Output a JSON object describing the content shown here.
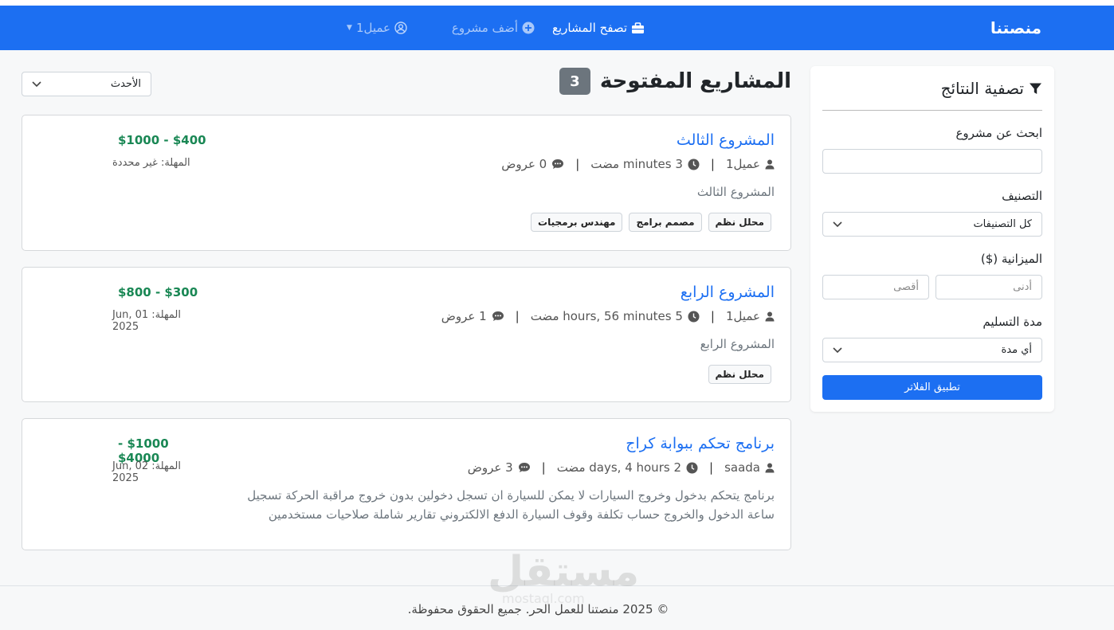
{
  "navbar": {
    "brand": "منصتنا",
    "links": [
      {
        "label": "تصفح المشاريع",
        "icon": "briefcase-icon",
        "active": true
      },
      {
        "label": "أضف مشروع",
        "icon": "plus-circle-icon",
        "active": false
      },
      {
        "label": "عميل1",
        "icon": "user-circle-icon",
        "active": false
      }
    ]
  },
  "filters": {
    "title": "تصفية النتائج",
    "search_label": "ابحث عن مشروع",
    "search_value": "",
    "category_label": "التصنيف",
    "category_value": "كل التصنيفات",
    "budget_label": "الميزانية ($)",
    "budget_min_placeholder": "أدنى",
    "budget_max_placeholder": "أقصى",
    "duration_label": "مدة التسليم",
    "duration_value": "أي مدة",
    "apply_label": "تطبيق الفلاتر"
  },
  "main": {
    "heading": "المشاريع المفتوحة",
    "count": "3",
    "sort_value": "الأحدث"
  },
  "projects": [
    {
      "title": "المشروع الثالث",
      "owner": "عميل1",
      "time": "3 minutes مضت",
      "offers": "0 عروض",
      "description": "المشروع الثالث",
      "price": "$400 - $1000",
      "deadline": "المهلة: غير محددة",
      "tags": [
        "محلل نظم",
        "مصمم برامج",
        "مهندس برمجيات"
      ]
    },
    {
      "title": "المشروع الرابع",
      "owner": "عميل1",
      "time": "5 hours, 56 minutes مضت",
      "offers": "1 عروض",
      "description": "المشروع الرابع",
      "price": "$300 - $800",
      "deadline": "المهلة: 01 Jun, 2025",
      "tags": [
        "محلل نظم"
      ]
    },
    {
      "title": "برنامج تحكم ببوابة كراج",
      "owner": "saada",
      "time": "2 days, 4 hours مضت",
      "offers": "3 عروض",
      "description": "برنامج يتحكم بدخول وخروج السيارات لا يمكن للسيارة ان تسجل دخولين بدون خروج مراقبة الحركة تسجيل ساعة الدخول والخروج حساب تكلفة وقوف السيارة الدفع الالكتروني تقارير شاملة صلاحيات مستخدمين",
      "price": "$1000 - $4000",
      "deadline": "المهلة: 02 Jun, 2025",
      "tags": []
    }
  ],
  "footer": {
    "text": "© 2025 منصتنا للعمل الحر. جميع الحقوق محفوظة."
  },
  "watermark": {
    "text": "مستقل",
    "sub": "mostaql.com"
  }
}
